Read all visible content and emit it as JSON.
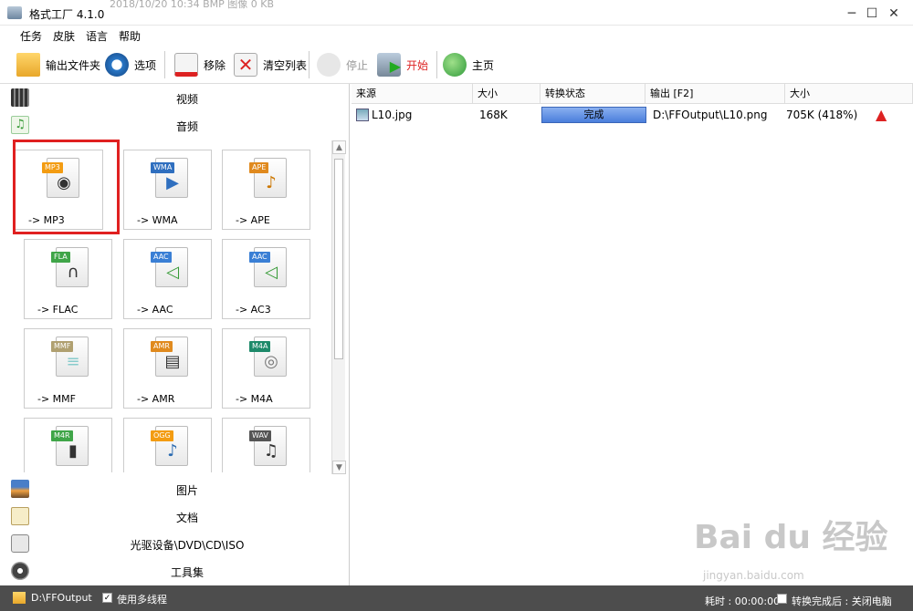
{
  "window": {
    "title": "格式工厂 4.1.0",
    "ghost_text": "2018/10/20 10:34    BMP 图像         0 KB"
  },
  "menu": [
    "任务",
    "皮肤",
    "语言",
    "帮助"
  ],
  "toolbar": {
    "output_folder": "输出文件夹",
    "options": "选项",
    "remove": "移除",
    "clear_list": "清空列表",
    "stop": "停止",
    "start": "开始",
    "home": "主页"
  },
  "categories": {
    "video": "视频",
    "audio": "音频",
    "image": "图片",
    "document": "文档",
    "rom": "光驱设备\\DVD\\CD\\ISO",
    "tools": "工具集"
  },
  "audio_tiles": [
    {
      "tag": "MP3",
      "label": "-> MP3",
      "tag_color": "#f39c12",
      "icon": "speaker-icon"
    },
    {
      "tag": "WMA",
      "label": "-> WMA",
      "tag_color": "#2f6fbf",
      "icon": "play-icon"
    },
    {
      "tag": "APE",
      "label": "-> APE",
      "tag_color": "#e08a1e",
      "icon": "guitar-icon"
    },
    {
      "tag": "FLA",
      "label": "-> FLAC",
      "tag_color": "#3fa548",
      "icon": "headphones-icon"
    },
    {
      "tag": "AAC",
      "label": "-> AAC",
      "tag_color": "#3a7fd5",
      "icon": "speaker-icon"
    },
    {
      "tag": "AAC",
      "label": "-> AC3",
      "tag_color": "#3a7fd5",
      "icon": "speaker-icon"
    },
    {
      "tag": "MMF",
      "label": "-> MMF",
      "tag_color": "#b0a070",
      "icon": "document-icon"
    },
    {
      "tag": "AMR",
      "label": "-> AMR",
      "tag_color": "#e08a1e",
      "icon": "phone-icon"
    },
    {
      "tag": "M4A",
      "label": "-> M4A",
      "tag_color": "#1e8a6a",
      "icon": "disc-icon"
    },
    {
      "tag": "M4R",
      "label": "",
      "tag_color": "#3fa548",
      "icon": "phone-icon"
    },
    {
      "tag": "OGG",
      "label": "",
      "tag_color": "#f39c12",
      "icon": "music-note-icon"
    },
    {
      "tag": "WAV",
      "label": "",
      "tag_color": "#555555",
      "icon": "music-notes-icon"
    }
  ],
  "table": {
    "headers": [
      "来源",
      "大小",
      "转换状态",
      "输出 [F2]",
      "大小"
    ],
    "rows": [
      {
        "source": "L10.jpg",
        "size": "168K",
        "status": "完成",
        "output": "D:\\FFOutput\\L10.png",
        "out_size": "705K  (418%)"
      }
    ]
  },
  "statusbar": {
    "output_path": "D:\\FFOutput",
    "multithread_label": "使用多线程",
    "elapsed": "耗时 : 00:00:00",
    "after_convert": "转换完成后 : 关闭电脑"
  },
  "watermark": {
    "brand": "Bai du 经验",
    "url": "jingyan.baidu.com"
  },
  "colors": {
    "highlight": "#e02020",
    "progress": "#4a7edc",
    "statusbar": "#4d4d4d"
  }
}
